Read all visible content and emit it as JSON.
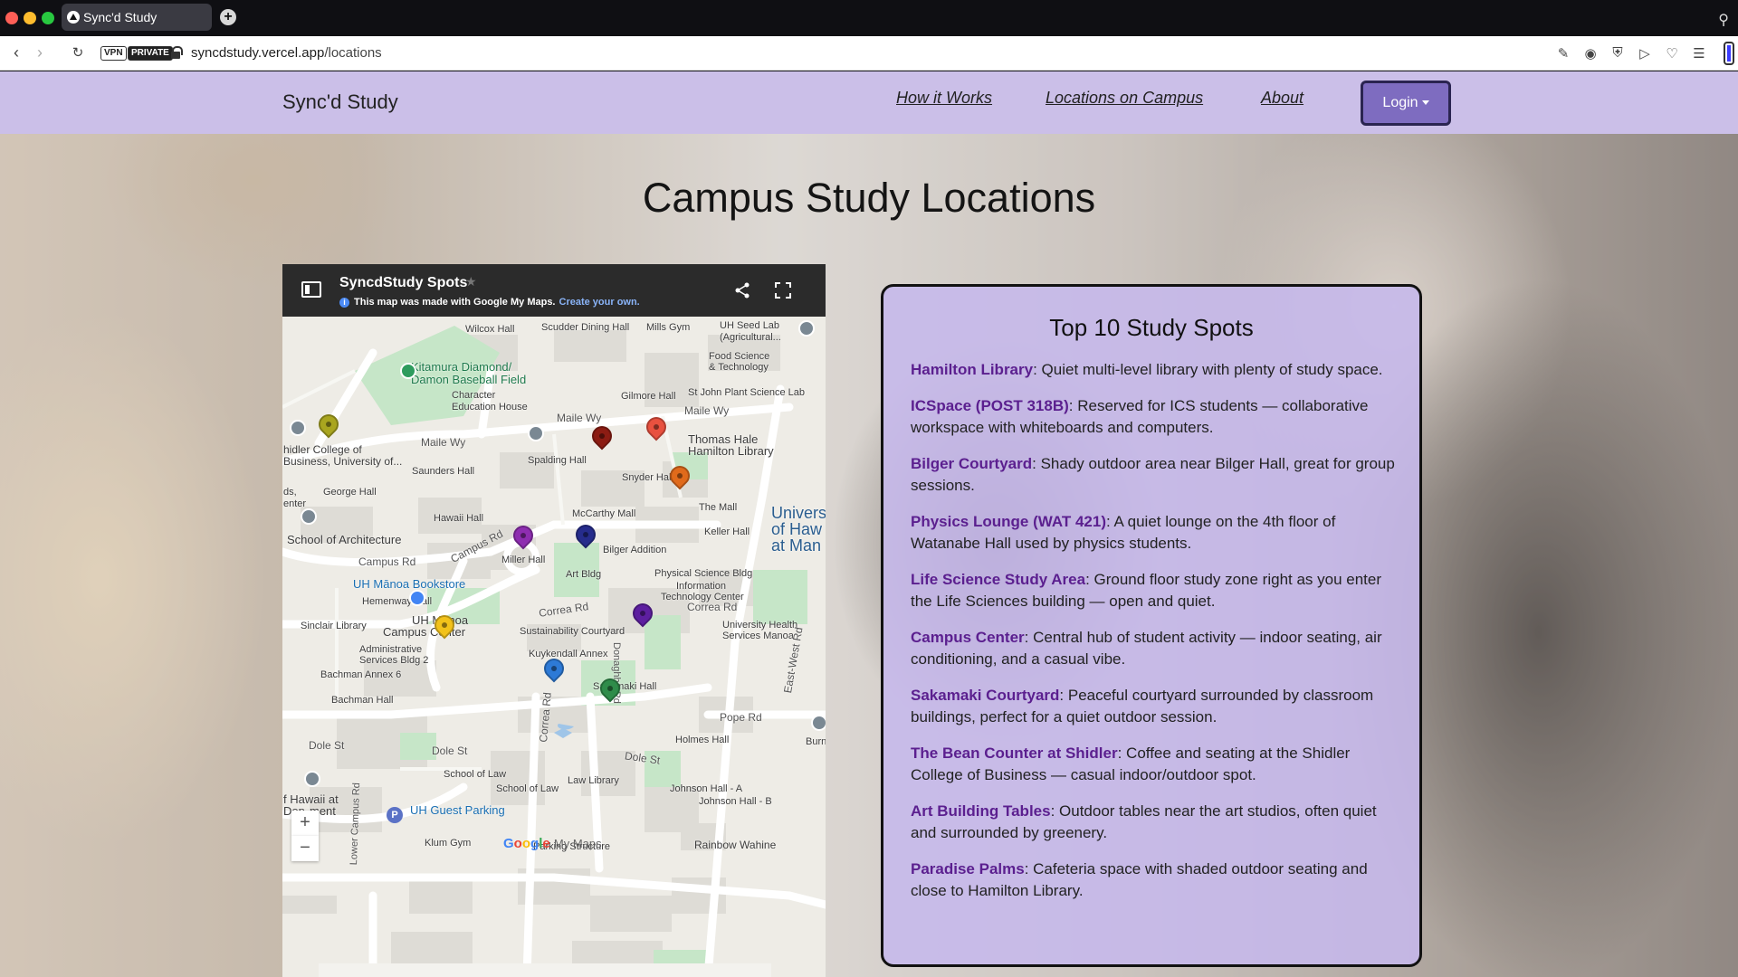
{
  "browser": {
    "tab_title": "Sync'd Study",
    "new_tab": "+",
    "vpn_badge": "VPN",
    "private_badge": "PRIVATE",
    "url_host": "syncdstudy.vercel.app",
    "url_path": "/locations"
  },
  "navbar": {
    "brand": "Sync'd Study",
    "links": [
      "How it Works",
      "Locations on Campus",
      "About"
    ],
    "login_label": "Login"
  },
  "page": {
    "title": "Campus Study Locations"
  },
  "map": {
    "title": "SyncdStudy Spots",
    "info_text": "This map was made with Google My Maps.",
    "create_link": "Create your own.",
    "zoom_in": "+",
    "zoom_out": "−",
    "logo_letters": [
      "G",
      "o",
      "o",
      "g",
      "l",
      "e"
    ],
    "logo_suffix": "My Maps",
    "labels": {
      "wilcox": "Wilcox Hall",
      "scudder": "Scudder Dining Hall",
      "mills": "Mills Gym",
      "seedlab": "UH Seed Lab",
      "agricultural": "(Agricultural...",
      "foodsci1": "Food Science",
      "foodsci2": "& Technology",
      "kitamura1": "Kitamura Diamond/",
      "kitamura2": "Damon Baseball Field",
      "character1": "Character",
      "character2": "Education House",
      "gilmore": "Gilmore Hall",
      "stjohn": "St John Plant Science Lab",
      "maileway1": "Maile Wy",
      "maileway2": "Maile Wy",
      "maileway3": "Maile Wy",
      "hamilton1": "Thomas Hale",
      "hamilton2": "Hamilton Library",
      "shidler1": "hidler College of",
      "shidler2": "Business, University of...",
      "spalding": "Spalding Hall",
      "saunders": "Saunders Hall",
      "snyder": "Snyder Hall",
      "ds": "ds,",
      "enter": "enter",
      "george": "George Hall",
      "mccarthy": "McCarthy Mall",
      "themall": "The Mall",
      "univ1": "Univers",
      "univ2": "of Haw",
      "univ3": "at Man",
      "hawaii": "Hawaii Hall",
      "keller": "Keller Hall",
      "architecture": "School of Architecture",
      "bilger": "Bilger Addition",
      "campusrd1": "Campus Rd",
      "campusrd2": "Campus Rd",
      "miller": "Miller Hall",
      "artbldg": "Art Bldg",
      "physci": "Physical Science Bldg",
      "itc1": "Information",
      "itc2": "Technology Center",
      "bookstore": "UH Mānoa Bookstore",
      "hemenway": "Hemenway Hall",
      "correa1": "Correa Rd",
      "correa2": "Correa Rd",
      "sinclair": "Sinclair Library",
      "campuscenter1": "UH Manoa",
      "campuscenter2": "Campus Center",
      "sustain": "Sustainability Courtyard",
      "uhs1": "University Health",
      "uhs2": "Services Manoa",
      "admin1": "Administrative",
      "admin2": "Services Bldg 2",
      "kuykendall": "Kuykendall Annex",
      "donaghho": "Donaghho Rd",
      "eastwest": "East-West Rd",
      "bachman6": "Bachman Annex 6",
      "sakamaki": "Sakamaki Hall",
      "bachman": "Bachman Hall",
      "correa3": "Correa Rd",
      "poperd": "Pope Rd",
      "holmes": "Holmes Hall",
      "dole1": "Dole St",
      "dole2": "Dole St",
      "dole3": "Dole St",
      "burns": "Burn",
      "lawschool": "School of Law",
      "lawschool2": "School of Law",
      "lawlib": "Law Library",
      "johnsona": "Johnson Hall - A",
      "johnsonb": "Johnson Hall - B",
      "uhhawaii1": "f Hawaii at",
      "uhhawaii2": "Dep",
      "uhhawaii3": "ment",
      "lowercampus": "Lower Campus Rd",
      "guestparking": "UH Guest Parking",
      "klum": "Klum Gym",
      "parkingstructure": "Parking Structure",
      "rainbow": "Rainbow Wahine"
    },
    "pin_colors": {
      "olive": "#a9a51f",
      "maroon": "#8c1c13",
      "red": "#e8513f",
      "orange": "#e06a1b",
      "purple": "#8e2db0",
      "navy": "#262c8c",
      "violet": "#5d1fa0",
      "yellow": "#f2c21a",
      "blue": "#2d7ad6",
      "green": "#2f8c4a"
    }
  },
  "top_spots": {
    "title": "Top 10 Study Spots",
    "items": [
      {
        "name": "Hamilton Library",
        "desc": ": Quiet multi-level library with plenty of study space."
      },
      {
        "name": "ICSpace (POST 318B)",
        "desc": ": Reserved for ICS students — collaborative workspace with whiteboards and computers."
      },
      {
        "name": "Bilger Courtyard",
        "desc": ": Shady outdoor area near Bilger Hall, great for group sessions."
      },
      {
        "name": "Physics Lounge (WAT 421)",
        "desc": ": A quiet lounge on the 4th floor of Watanabe Hall used by physics students."
      },
      {
        "name": "Life Science Study Area",
        "desc": ": Ground floor study zone right as you enter the Life Sciences building — open and quiet."
      },
      {
        "name": "Campus Center",
        "desc": ": Central hub of student activity — indoor seating, air conditioning, and a casual vibe."
      },
      {
        "name": "Sakamaki Courtyard",
        "desc": ": Peaceful courtyard surrounded by classroom buildings, perfect for a quiet outdoor session."
      },
      {
        "name": "The Bean Counter at Shidler",
        "desc": ": Coffee and seating at the Shidler College of Business — casual indoor/outdoor spot."
      },
      {
        "name": "Art Building Tables",
        "desc": ": Outdoor tables near the art studios, often quiet and surrounded by greenery."
      },
      {
        "name": "Paradise Palms",
        "desc": ": Cafeteria space with shaded outdoor seating and close to Hamilton Library."
      }
    ]
  },
  "colors": {
    "navbar_bg": "#cbbfe8",
    "login_bg": "#7e6cc0",
    "card_bg": "#c6b8ec",
    "spot_name": "#5b1f8f"
  }
}
